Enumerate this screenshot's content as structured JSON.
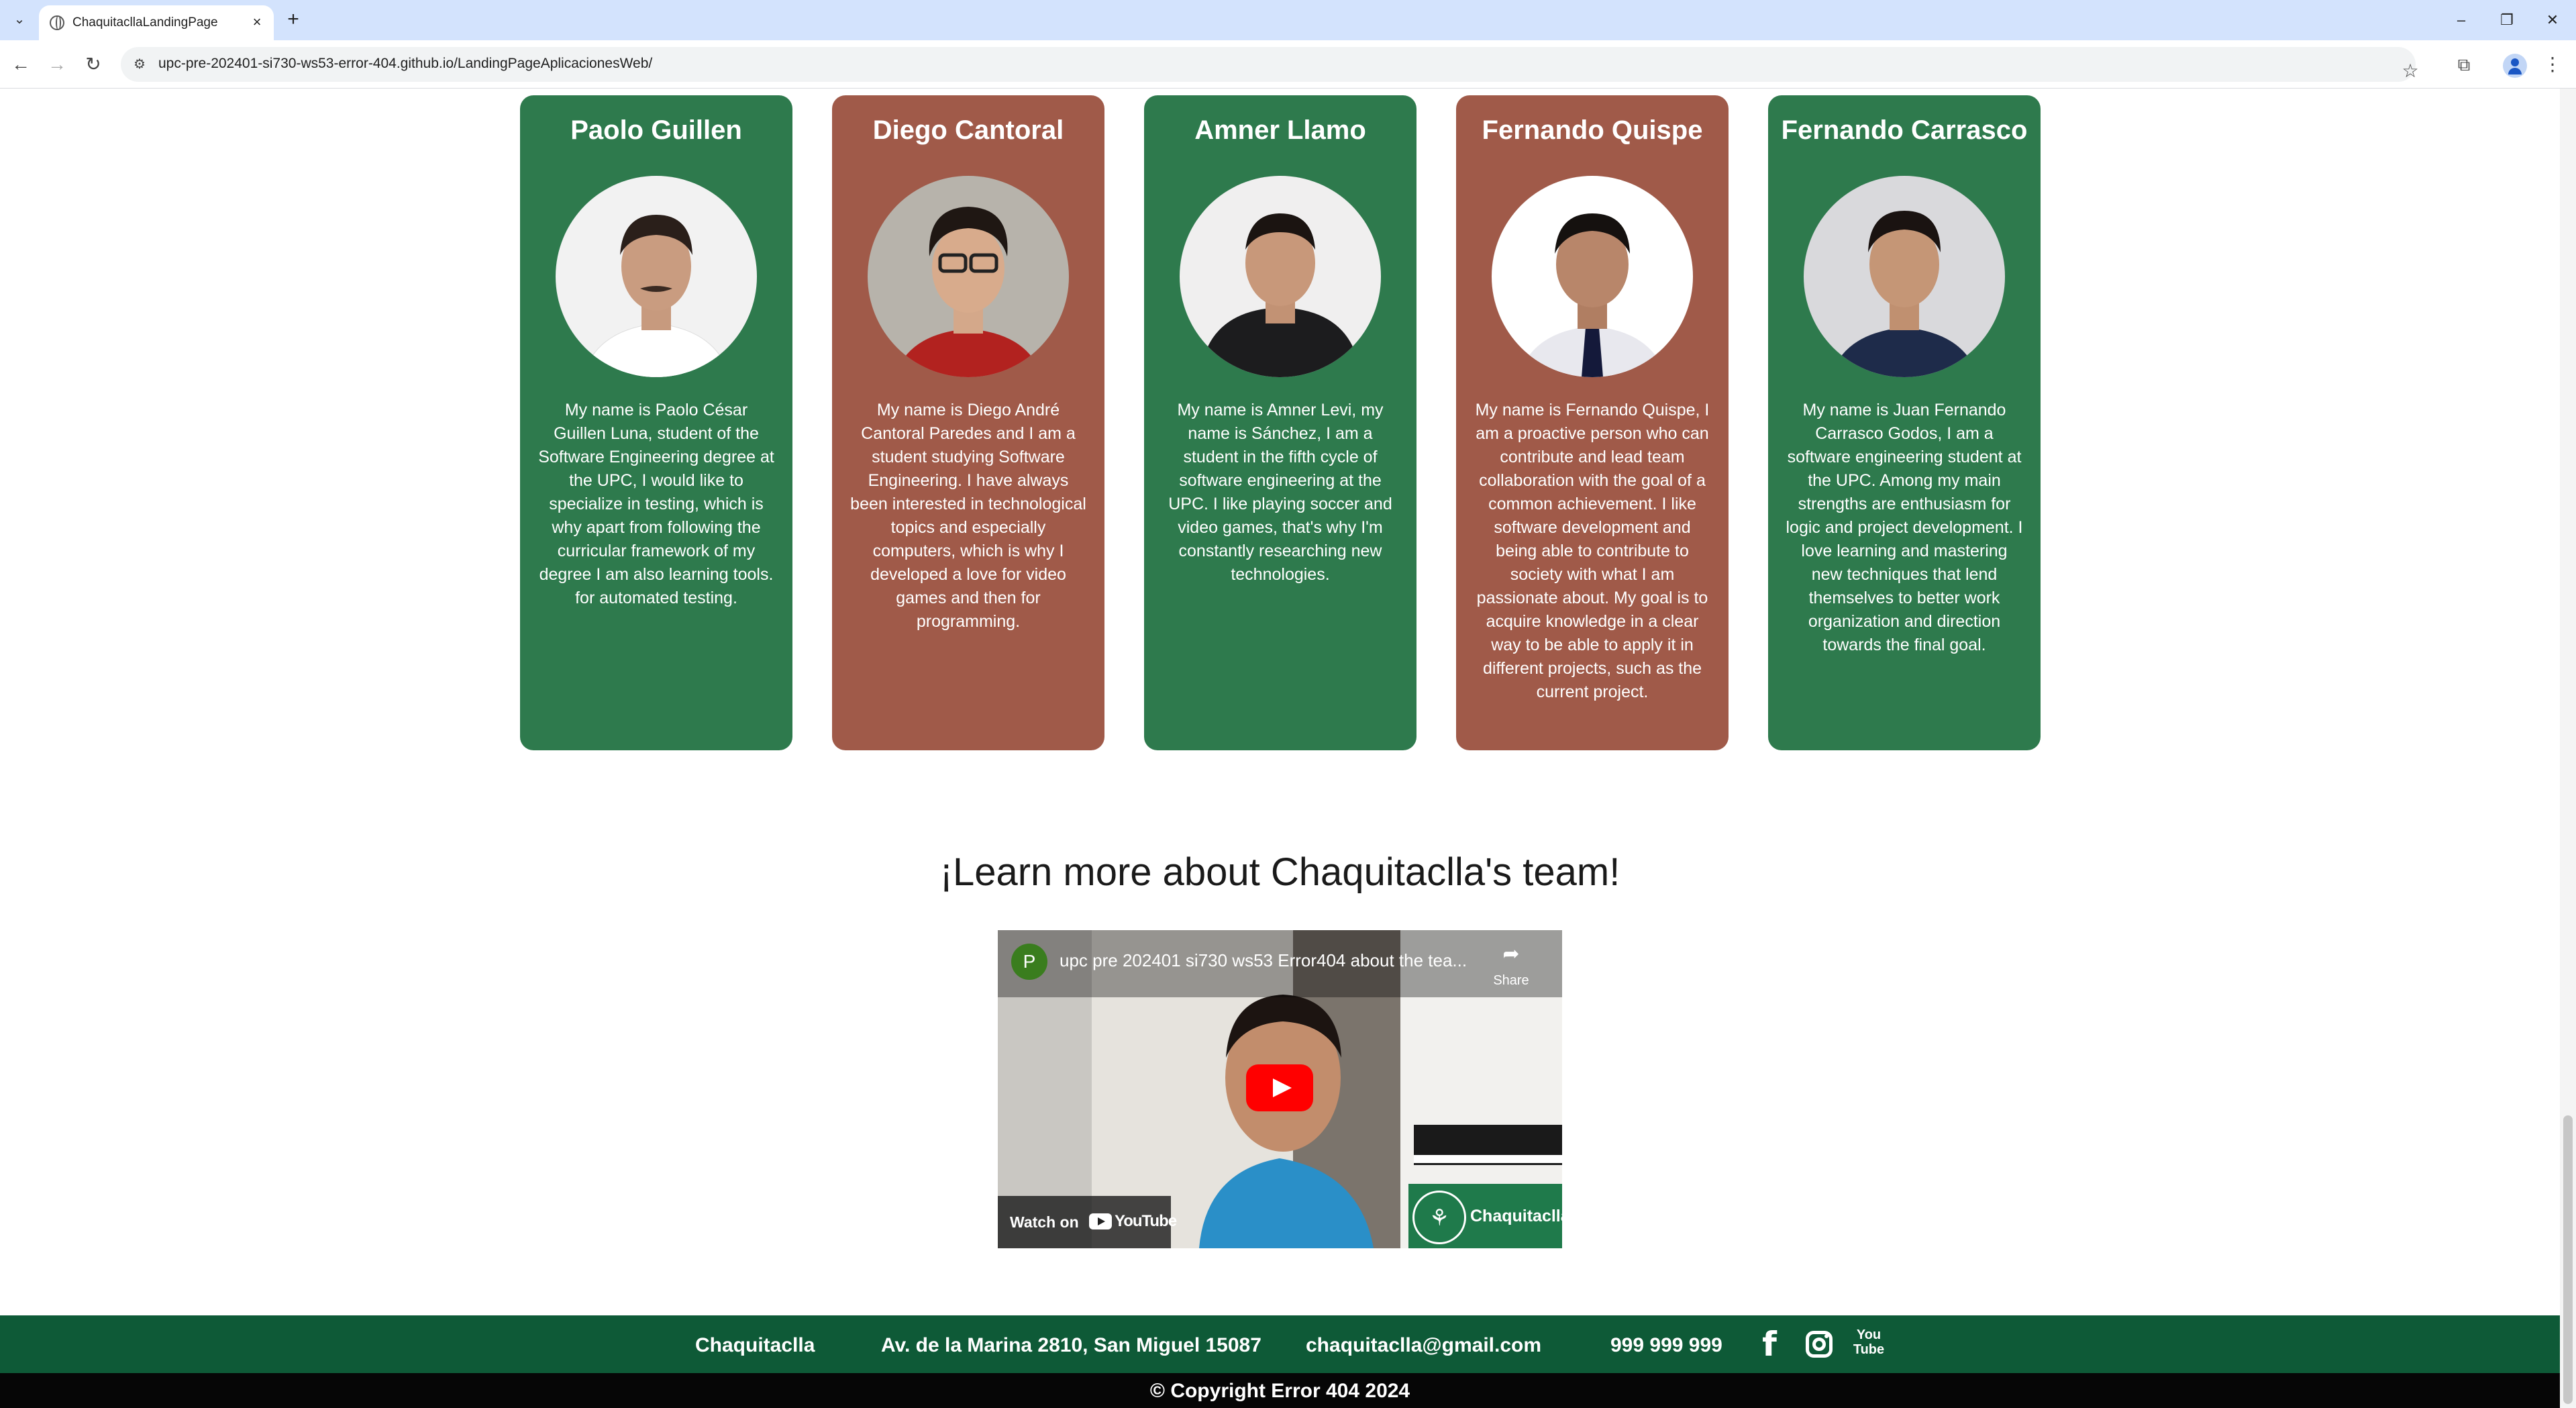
{
  "browser": {
    "tab_title": "ChaquitacllaLandingPage",
    "url": "upc-pre-202401-si730-ws53-error-404.github.io/LandingPageAplicacionesWeb/"
  },
  "team": {
    "members": [
      {
        "name": "Paolo Guillen",
        "bio": "My name is Paolo César Guillen Luna, student of the Software Engineering degree at the UPC, I would like to specialize in testing, which is why apart from following the curricular framework of my degree I am also learning tools. for automated testing.",
        "card_color": "#2e7a4d"
      },
      {
        "name": "Diego Cantoral",
        "bio": "My name is Diego André Cantoral Paredes and I am a student studying Software Engineering. I have always been interested in technological topics and especially computers, which is why I developed a love for video games and then for programming.",
        "card_color": "#a05a49"
      },
      {
        "name": "Amner Llamo",
        "bio": "My name is Amner Levi, my name is Sánchez, I am a student in the fifth cycle of software engineering at the UPC. I like playing soccer and video games, that's why I'm constantly researching new technologies.",
        "card_color": "#2e7a4d"
      },
      {
        "name": "Fernando Quispe",
        "bio": "My name is Fernando Quispe, I am a proactive person who can contribute and lead team collaboration with the goal of a common achievement. I like software development and being able to contribute to society with what I am passionate about. My goal is to acquire knowledge in a clear way to be able to apply it in different projects, such as the current project.",
        "card_color": "#a05a49"
      },
      {
        "name": "Fernando Carrasco",
        "bio": "My name is Juan Fernando Carrasco Godos, I am a software engineering student at the UPC. Among my main strengths are enthusiasm for logic and project development. I love learning and mastering new techniques that lend themselves to better work organization and direction towards the final goal.",
        "card_color": "#2e7a4d"
      }
    ]
  },
  "video_section": {
    "title": "¡Learn more about Chaquitaclla's team!",
    "video": {
      "channel_initial": "P",
      "title": "upc pre 202401 si730 ws53 Error404 about the tea...",
      "share_label": "Share",
      "watch_on": "Watch on",
      "youtube_wordmark": "YouTube",
      "badge_text": "Chaquitaclla"
    }
  },
  "footer": {
    "brand": "Chaquitaclla",
    "address": "Av. de la Marina 2810, San Miguel 15087",
    "email": "chaquitaclla@gmail.com",
    "phone": "999 999 999",
    "social": [
      "facebook-icon",
      "instagram-icon",
      "youtube-icon"
    ],
    "youtube_icon_text_1": "You",
    "youtube_icon_text_2": "Tube",
    "copyright": "© Copyright Error 404 2024"
  },
  "colors": {
    "green": "#2e7a4d",
    "brown": "#a05a49",
    "footer": "#0e5a37",
    "copyright_bar": "#060606"
  }
}
